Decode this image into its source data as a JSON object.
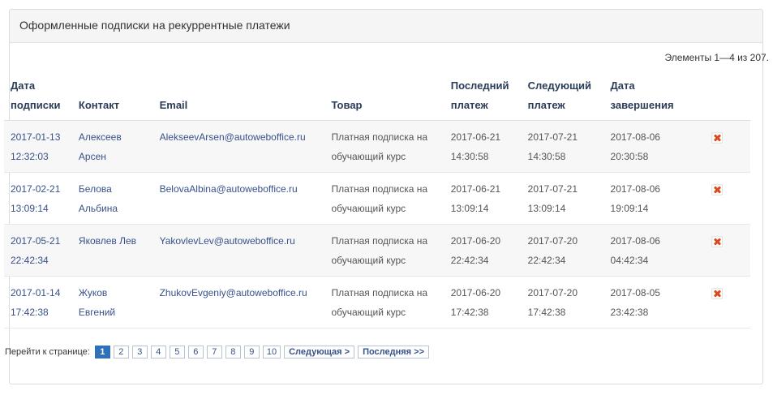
{
  "panel": {
    "title": "Оформленные подписки на рекуррентные платежи",
    "summary": "Элементы 1—4 из 207."
  },
  "table": {
    "columns": {
      "date_l1": "Дата",
      "date_l2": "подписки",
      "contact": "Контакт",
      "email": "Email",
      "product": "Товар",
      "last_l1": "Последний",
      "last_l2": "платеж",
      "next_l1": "Следующий",
      "next_l2": "платеж",
      "end_l1": "Дата",
      "end_l2": "завершения"
    },
    "rows": [
      {
        "date": "2017-01-13",
        "time": "12:32:03",
        "contact_l1": "Алексеев",
        "contact_l2": "Арсен",
        "email": "AlekseevArsen@autowebоffice.ru",
        "product_l1": "Платная подписка на",
        "product_l2": "обучающий курс",
        "last_date": "2017-06-21",
        "last_time": "14:30:58",
        "next_date": "2017-07-21",
        "next_time": "14:30:58",
        "end_date": "2017-08-06",
        "end_time": "20:30:58"
      },
      {
        "date": "2017-02-21",
        "time": "13:09:14",
        "contact_l1": "Белова",
        "contact_l2": "Альбина",
        "email": "BelovaAlbina@autoweboffice.ru",
        "product_l1": "Платная подписка на",
        "product_l2": "обучающий курс",
        "last_date": "2017-06-21",
        "last_time": "13:09:14",
        "next_date": "2017-07-21",
        "next_time": "13:09:14",
        "end_date": "2017-08-06",
        "end_time": "19:09:14"
      },
      {
        "date": "2017-05-21",
        "time": "22:42:34",
        "contact_l1": "Яковлев Лев",
        "contact_l2": "",
        "email": "YakovlevLev@autoweboffice.ru",
        "product_l1": "Платная подписка на",
        "product_l2": "обучающий курс",
        "last_date": "2017-06-20",
        "last_time": "22:42:34",
        "next_date": "2017-07-20",
        "next_time": "22:42:34",
        "end_date": "2017-08-06",
        "end_time": "04:42:34"
      },
      {
        "date": "2017-01-14",
        "time": "17:42:38",
        "contact_l1": "Жуков Евгений",
        "contact_l2": "",
        "email": "ZhukovEvgeniy@autoweboffice.ru",
        "product_l1": "Платная подписка на",
        "product_l2": "обучающий курс",
        "last_date": "2017-06-20",
        "last_time": "17:42:38",
        "next_date": "2017-07-20",
        "next_time": "17:42:38",
        "end_date": "2017-08-05",
        "end_time": "23:42:38"
      }
    ],
    "row_action_icon": "delete-icon"
  },
  "pager": {
    "label": "Перейти к странице:",
    "pages": [
      "1",
      "2",
      "3",
      "4",
      "5",
      "6",
      "7",
      "8",
      "9",
      "10"
    ],
    "current_page": "1",
    "next_label": "Следующая >",
    "last_label": "Последняя >>"
  },
  "colors": {
    "link": "#37518a",
    "header_text": "#2a3c57",
    "active_page": "#2f71b9",
    "delete_icon": "#d84a1c"
  }
}
